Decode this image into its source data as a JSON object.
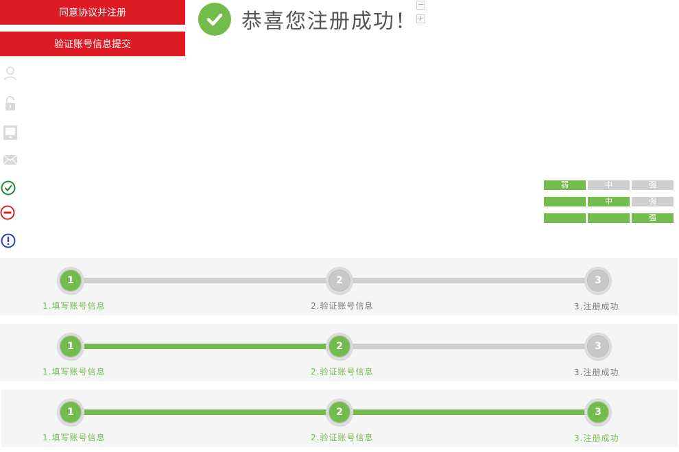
{
  "buttons": {
    "agree_register": "同意协议并注册",
    "verify_account": "验证账号信息提交"
  },
  "sidebar_icons": [
    {
      "name": "user-icon",
      "color": "#dcdcdc"
    },
    {
      "name": "unlock-icon",
      "color": "#dcdcdc"
    },
    {
      "name": "computer-icon",
      "color": "#dcdcdc"
    },
    {
      "name": "mail-icon",
      "color": "#dcdcdc"
    },
    {
      "name": "check-circle-icon",
      "color": "#1a8a3a"
    },
    {
      "name": "minus-circle-icon",
      "color": "#d8232a"
    },
    {
      "name": "exclamation-circle-icon",
      "color": "#2a3fb5"
    }
  ],
  "success": {
    "title": "恭喜您注册成功！",
    "icon": "check-icon",
    "collapse_icon": "minus-square-icon",
    "expand_icon": "plus-square-icon"
  },
  "password_strength": [
    {
      "labels": [
        "弱",
        "中",
        "强"
      ],
      "active": [
        true,
        false,
        false
      ]
    },
    {
      "labels": [
        "",
        "中",
        "强"
      ],
      "active": [
        true,
        true,
        false
      ]
    },
    {
      "labels": [
        "",
        "",
        "强"
      ],
      "active": [
        true,
        true,
        true
      ]
    }
  ],
  "progress": {
    "steps": [
      {
        "number": "1",
        "label": "1.填写账号信息"
      },
      {
        "number": "2",
        "label": "2.验证账号信息"
      },
      {
        "number": "3",
        "label": "3.注册成功"
      }
    ],
    "current_step": [
      1,
      2,
      3
    ]
  },
  "colors": {
    "primary_red": "#dd1b22",
    "success_green": "#72bc4d",
    "inactive_gray": "#cfcfcf"
  }
}
